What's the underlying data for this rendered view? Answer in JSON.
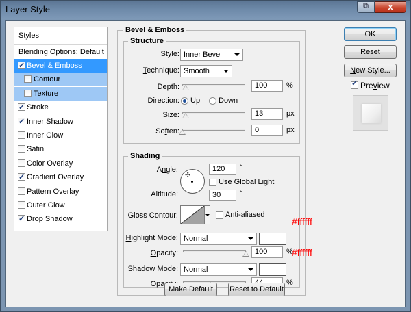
{
  "window": {
    "title": "Layer Style",
    "help_glyph": "⧉",
    "close_glyph": "x"
  },
  "sidebar": {
    "styles_label": "Styles",
    "blending_label": "Blending Options: Default",
    "items": [
      {
        "label": "Bevel & Emboss",
        "checked": true,
        "state": "selected"
      },
      {
        "label": "Contour",
        "checked": false,
        "state": "sub"
      },
      {
        "label": "Texture",
        "checked": false,
        "state": "sub"
      },
      {
        "label": "Stroke",
        "checked": true,
        "state": "normal"
      },
      {
        "label": "Inner Shadow",
        "checked": true,
        "state": "normal"
      },
      {
        "label": "Inner Glow",
        "checked": false,
        "state": "normal"
      },
      {
        "label": "Satin",
        "checked": false,
        "state": "normal"
      },
      {
        "label": "Color Overlay",
        "checked": false,
        "state": "normal"
      },
      {
        "label": "Gradient Overlay",
        "checked": true,
        "state": "normal"
      },
      {
        "label": "Pattern Overlay",
        "checked": false,
        "state": "normal"
      },
      {
        "label": "Outer Glow",
        "checked": false,
        "state": "normal"
      },
      {
        "label": "Drop Shadow",
        "checked": true,
        "state": "normal"
      }
    ]
  },
  "bevel": {
    "title": "Bevel & Emboss",
    "structure": {
      "title": "Structure",
      "style_label": "Style:",
      "style_value": "Inner Bevel",
      "technique_label": "Technique:",
      "technique_value": "Smooth",
      "depth_label": "Depth:",
      "depth_value": "100",
      "depth_unit": "%",
      "direction_label": "Direction:",
      "dir_up": "Up",
      "dir_down": "Down",
      "direction_selected": "Up",
      "size_label": "Size:",
      "size_value": "13",
      "size_unit": "px",
      "soften_label": "Soften:",
      "soften_value": "0",
      "soften_unit": "px"
    },
    "shading": {
      "title": "Shading",
      "angle_label": "Angle:",
      "angle_value": "120",
      "angle_unit": "°",
      "global_light_label": "Use Global Light",
      "global_light_checked": false,
      "altitude_label": "Altitude:",
      "altitude_value": "30",
      "altitude_unit": "°",
      "gloss_label": "Gloss Contour:",
      "anti_aliased_label": "Anti-aliased",
      "anti_aliased_checked": false,
      "highlight_label": "Highlight Mode:",
      "highlight_value": "Normal",
      "highlight_color": "#ffffff",
      "highlight_opacity_label": "Opacity:",
      "highlight_opacity_value": "100",
      "highlight_opacity_unit": "%",
      "shadow_label": "Shadow Mode:",
      "shadow_value": "Normal",
      "shadow_color": "#ffffff",
      "shadow_opacity_label": "Opacity:",
      "shadow_opacity_value": "44",
      "shadow_opacity_unit": "%"
    },
    "make_default_label": "Make Default",
    "reset_default_label": "Reset to Default"
  },
  "annotations": {
    "highlight_hex": "#ffffff",
    "shadow_hex": "#ffffff"
  },
  "actions": {
    "ok_label": "OK",
    "reset_label": "Reset",
    "new_style_label": "New Style...",
    "preview_label": "Preview",
    "preview_checked": true
  },
  "sliders": {
    "depth": 0.05,
    "size": 0.05,
    "soften": 0.0,
    "highlight_opacity": 1.0,
    "shadow_opacity": 0.44
  },
  "colors": {
    "selected": "#3399ff",
    "sub": "#9ec8f5",
    "annotation": "#ff0000"
  }
}
